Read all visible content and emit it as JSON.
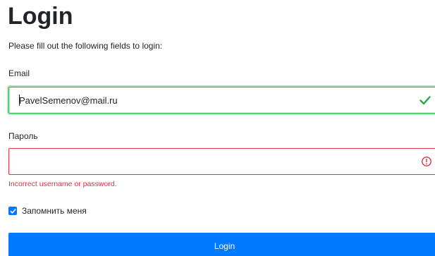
{
  "page": {
    "title": "Login",
    "subtitle": "Please fill out the following fields to login:"
  },
  "email": {
    "label": "Email",
    "value": "PavelSemenov@mail.ru",
    "state": "valid",
    "icon": "check-icon"
  },
  "password": {
    "label": "Пароль",
    "value": "",
    "state": "invalid",
    "icon": "error-circle-icon",
    "error": "Incorrect username or password."
  },
  "remember": {
    "label": "Запомнить меня",
    "checked": true
  },
  "submit": {
    "label": "Login"
  },
  "colors": {
    "primary": "#007bff",
    "valid": "#28a745",
    "invalid": "#dc3545",
    "text": "#212529"
  }
}
